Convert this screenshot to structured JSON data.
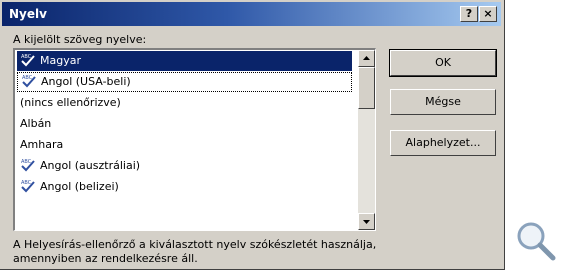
{
  "dialog": {
    "title": "Nyelv",
    "help_label": "?",
    "close_label": "×",
    "list_label": "A kijelölt szöveg nyelve:",
    "languages": [
      {
        "label": "Magyar",
        "spellcheck": true,
        "selected": true
      },
      {
        "label": "Angol (USA-beli)",
        "spellcheck": true,
        "focused": true
      },
      {
        "label": "(nincs ellenőrizve)",
        "spellcheck": false
      },
      {
        "label": "Albán",
        "spellcheck": false
      },
      {
        "label": "Amhara",
        "spellcheck": false
      },
      {
        "label": "Angol (ausztráliai)",
        "spellcheck": true
      },
      {
        "label": "Angol (belizei)",
        "spellcheck": true
      }
    ],
    "buttons": {
      "ok": "OK",
      "cancel": "Mégse",
      "default": "Alaphelyzet..."
    },
    "footer_line1": "A Helyesírás-ellenőrző a kiválasztott nyelv szókészletét használja,",
    "footer_line2": "amennyiben az rendelkezésre áll."
  },
  "colors": {
    "selection": "#0a246a",
    "dialog_bg": "#d4d0c8"
  }
}
